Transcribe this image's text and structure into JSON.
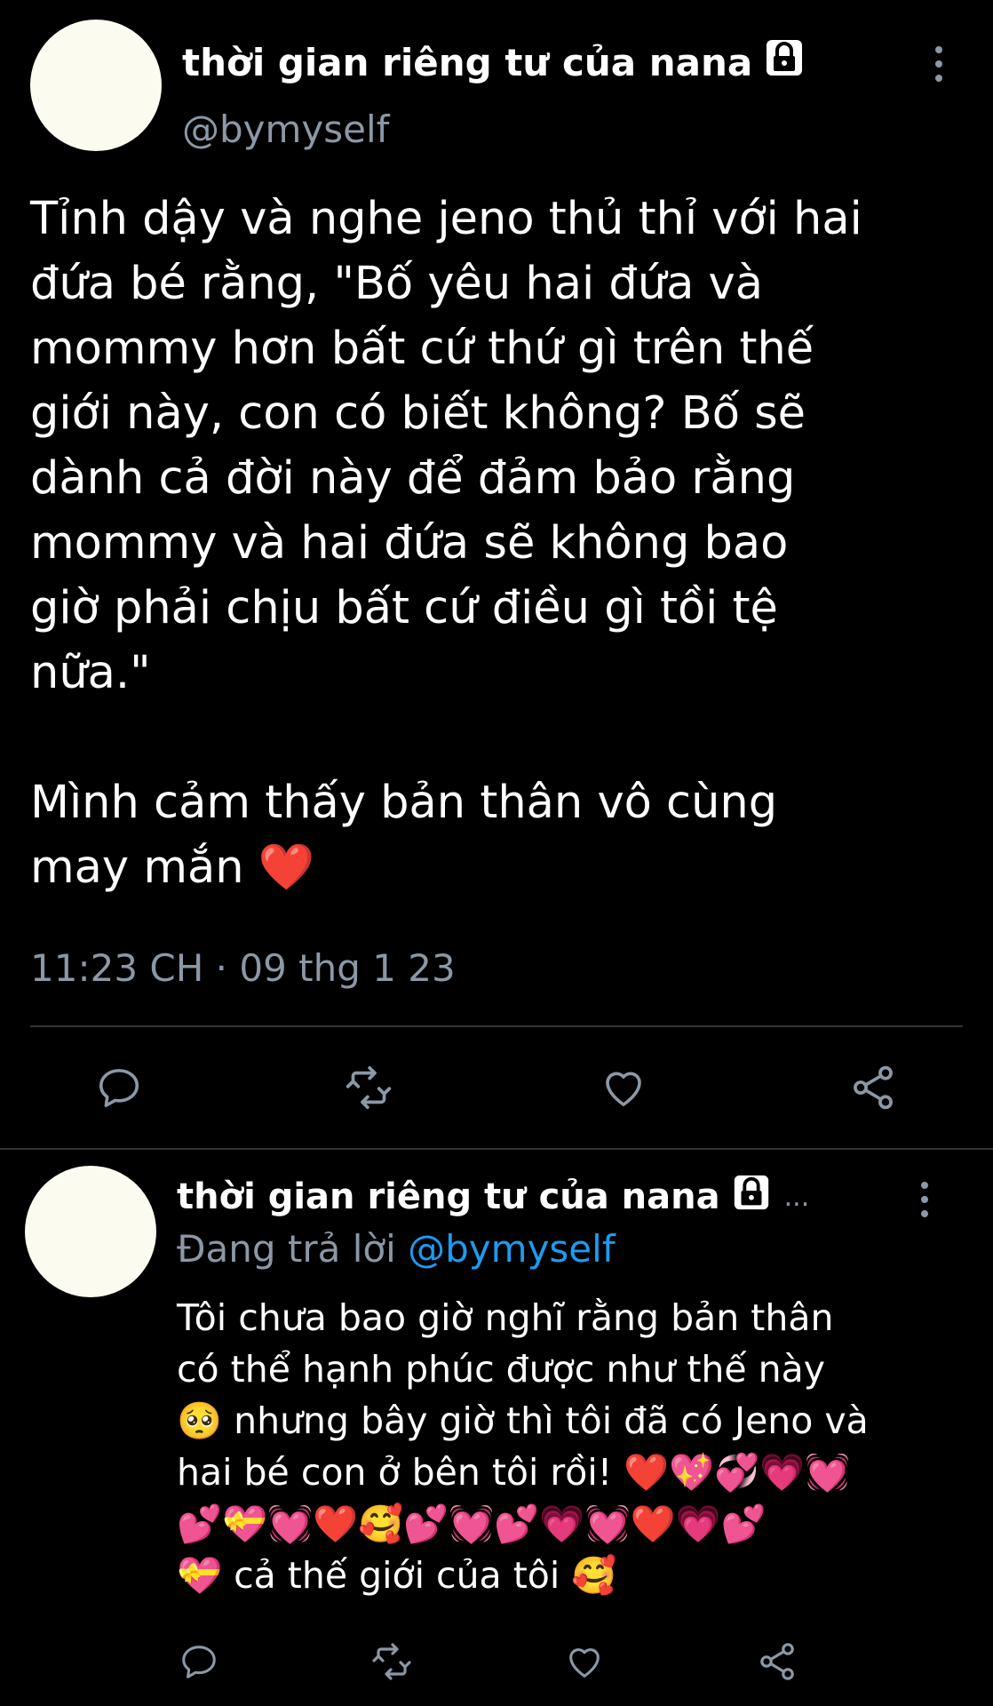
{
  "main_tweet": {
    "display_name": "thời gian riêng tư của nana",
    "handle": "@bymyself",
    "text": "Tỉnh dậy và nghe jeno thủ thỉ với hai\nđứa bé rằng, \"Bố yêu hai đứa và\nmommy hơn bất cứ thứ gì trên thế\ngiới này, con có biết không? Bố sẽ\ndành cả đời này để đảm bảo rằng\nmommy và hai đứa sẽ không bao\ngiờ phải chịu bất cứ điều gì tồi tệ\nnữa.\"\n\nMình cảm thấy bản thân vô cùng\nmay mắn ❤️",
    "timestamp": "11:23 CH · 09 thg 1 23",
    "icons": {
      "lock": "lock-icon",
      "more": "more-vertical-icon",
      "reply": "reply-icon",
      "retweet": "retweet-icon",
      "like": "heart-icon",
      "share": "share-icon"
    }
  },
  "reply_tweet": {
    "display_name": "thời gian riêng tư của nana",
    "ellipsis": "...",
    "reply_prefix": "Đang trả lời",
    "reply_mention": "@bymyself",
    "text": "Tôi chưa bao giờ nghĩ rằng bản thân\ncó thể hạnh phúc được như thế này\n🥺 nhưng bây giờ thì tôi đã có Jeno và\nhai bé con ở bên tôi rồi! ❤️💖💞💗💓\n💕💝💓❤️🥰💕💓💕💗💓❤️💗💕\n💝 cả thế giới của tôi 🥰"
  },
  "colors": {
    "background": "#000000",
    "text_primary": "#ffffff",
    "text_secondary": "#8b98a5",
    "accent": "#1d9bf0",
    "divider": "#2f3336",
    "avatar": "#fbfbef"
  }
}
